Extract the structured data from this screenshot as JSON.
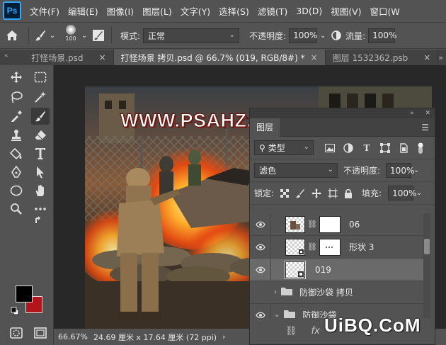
{
  "app": {
    "logo": "Ps"
  },
  "menu": [
    "文件(F)",
    "编辑(E)",
    "图像(I)",
    "图层(L)",
    "文字(Y)",
    "选择(S)",
    "滤镜(T)",
    "3D(D)",
    "视图(V)",
    "窗口(W"
  ],
  "options": {
    "brush_size": "100",
    "mode_label": "模式:",
    "mode_value": "正常",
    "opacity_label": "不透明度:",
    "opacity_value": "100%",
    "flow_label": "流量:",
    "flow_value": "100%"
  },
  "tabs": [
    {
      "label": "打怪场景.psd",
      "close": "×"
    },
    {
      "label": "打怪场景 拷贝.psd @ 66.7% (019, RGB/8#) *",
      "close": "×"
    },
    {
      "label": "图层 1532362.psb",
      "close": "×"
    }
  ],
  "tabbar": {
    "collapse": "«",
    "more": "»"
  },
  "canvas": {
    "watermark": "WWW.PSAHZ.COM"
  },
  "status": {
    "zoom": "66.67%",
    "doc_size": "24.69 厘米 x 17.64 厘米 (72 ppi)",
    "arrow": "›"
  },
  "colors": {
    "foreground": "#000000",
    "background": "#b2161c"
  },
  "layers_panel": {
    "title": "图层",
    "filter_label": "类型",
    "blend_mode": "滤色",
    "opacity_label": "不透明度:",
    "opacity_value": "100%",
    "lock_label": "锁定:",
    "fill_label": "填充:",
    "fill_value": "100%",
    "layers": [
      {
        "name": "06",
        "type": "pixel-mask",
        "selected": false
      },
      {
        "name": "形状 3",
        "type": "shape-mask",
        "selected": false
      },
      {
        "name": "019",
        "type": "smart",
        "selected": true
      },
      {
        "name": "防御沙袋 拷贝",
        "type": "group",
        "selected": false
      },
      {
        "name": "防御沙袋",
        "type": "group-open",
        "selected": false
      }
    ],
    "footer": {
      "fx": "fx"
    }
  },
  "site_watermark": "UiBQ.CoM"
}
